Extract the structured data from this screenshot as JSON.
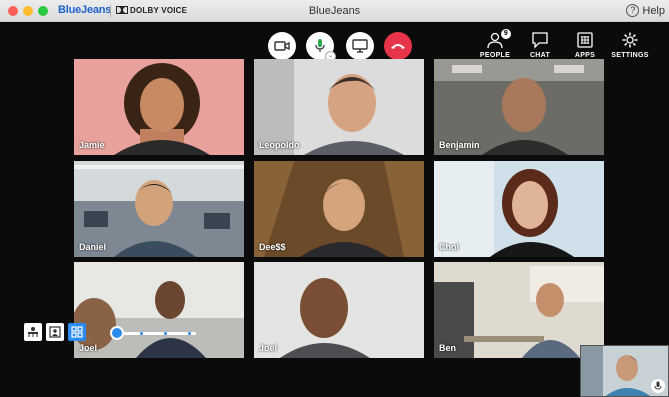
{
  "window": {
    "brand": "BlueJeans",
    "partner": "DOLBY VOICE",
    "title": "BlueJeans",
    "help_label": "Help"
  },
  "toolbar": {
    "tools": [
      {
        "label": "PEOPLE",
        "badge": "9"
      },
      {
        "label": "CHAT"
      },
      {
        "label": "APPS"
      },
      {
        "label": "SETTINGS"
      }
    ]
  },
  "participants": [
    {
      "name": "Jamie"
    },
    {
      "name": "Leopoldo"
    },
    {
      "name": "Benjamin"
    },
    {
      "name": "Daniel"
    },
    {
      "name": "Dee$$"
    },
    {
      "name": "Choi"
    },
    {
      "name": "Joel"
    },
    {
      "name": "Joel"
    },
    {
      "name": "Ben"
    }
  ],
  "colors": {
    "end_call": "#e8344a",
    "accent": "#2a8cf0",
    "brand": "#1a63c9"
  }
}
